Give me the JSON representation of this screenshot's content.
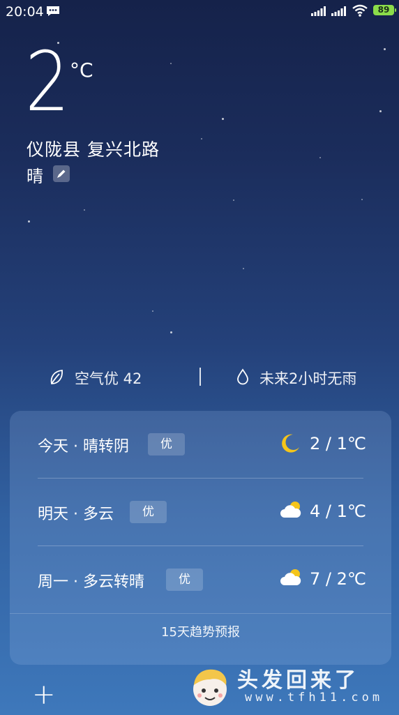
{
  "status_bar": {
    "time": "20:04",
    "battery": "89",
    "icons": [
      "message-icon",
      "signal-icon",
      "signal-icon",
      "wifi-icon",
      "battery-icon"
    ]
  },
  "current": {
    "temperature": "2",
    "unit": "°C",
    "location": "仪陇县  复兴北路",
    "condition": "晴",
    "edit_icon": "pencil-icon"
  },
  "summary": {
    "air_quality": "空气优 42",
    "air_icon": "leaf-icon",
    "rain_forecast": "未来2小时无雨",
    "rain_icon": "raindrop-icon"
  },
  "forecast": [
    {
      "day": "今天 · 晴转阴",
      "aqi": "优",
      "icon": "moon-icon",
      "range": "2 / 1℃"
    },
    {
      "day": "明天 · 多云",
      "aqi": "优",
      "icon": "cloudy-icon",
      "range": "4 / 1℃"
    },
    {
      "day": "周一 · 多云转晴",
      "aqi": "优",
      "icon": "cloudy-icon",
      "range": "7 / 2℃"
    }
  ],
  "trend_label": "15天趋势预报",
  "add_city_label": "+",
  "watermark": {
    "text": "头发回来了",
    "url": "www.tfh11.com"
  },
  "colors": {
    "bg_top": "#15224a",
    "bg_bottom": "#3e78bb",
    "battery": "#8bdc4a",
    "sun": "#f5c51a"
  }
}
